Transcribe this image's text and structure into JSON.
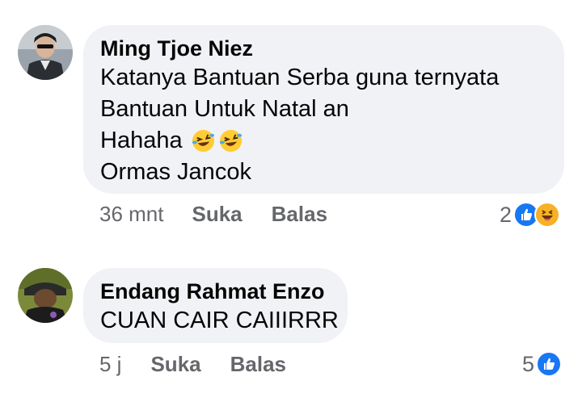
{
  "comments": [
    {
      "author": "Ming Tjoe Niez",
      "lines": [
        "Katanya Bantuan Serba guna ternyata",
        "Bantuan Untuk Natal an",
        "Hahaha",
        "Ormas Jancok"
      ],
      "emojis": [
        "rolling-on-floor-laughing-emoji",
        "rolling-on-floor-laughing-emoji"
      ],
      "time": "36 mnt",
      "like_label": "Suka",
      "reply_label": "Balas",
      "reaction_count": "2",
      "reaction_icons": [
        "like-icon",
        "haha-icon"
      ]
    },
    {
      "author": "Endang Rahmat Enzo",
      "lines": [
        "CUAN CAIR CAIIIRRR"
      ],
      "time": "5 j",
      "like_label": "Suka",
      "reply_label": "Balas",
      "reaction_count": "5",
      "reaction_icons": [
        "like-icon"
      ]
    }
  ],
  "colors": {
    "bubble": "#f0f2f5",
    "text": "#050505",
    "meta": "#65676b",
    "like": "#1877f2",
    "haha": "#f7b125"
  }
}
